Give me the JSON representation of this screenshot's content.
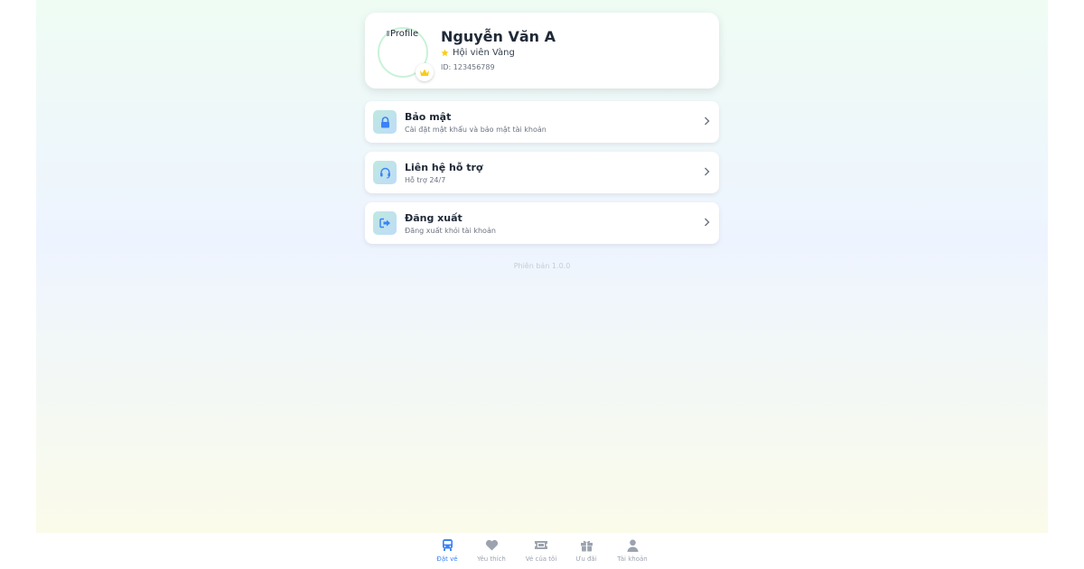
{
  "profile": {
    "avatar_alt": "Profile",
    "name": "Nguyễn Văn A",
    "membership": "Hội viên Vàng",
    "user_id": "ID: 123456789"
  },
  "menu": {
    "items": [
      {
        "title": "Bảo mật",
        "description": "Cài đặt mật khẩu và bảo mật tài khoản",
        "icon": "lock-icon"
      },
      {
        "title": "Liên hệ hỗ trợ",
        "description": "Hỗ trợ 24/7",
        "icon": "headset-icon"
      },
      {
        "title": "Đăng xuất",
        "description": "Đăng xuất khỏi tài khoản",
        "icon": "logout-icon"
      }
    ]
  },
  "version": "Phiên bản 1.0.0",
  "nav": {
    "active_index": 0,
    "items": [
      {
        "label": "Đặt vé",
        "icon": "bus-icon"
      },
      {
        "label": "Yêu thích",
        "icon": "heart-icon"
      },
      {
        "label": "Vé của tôi",
        "icon": "ticket-icon"
      },
      {
        "label": "Ưu đãi",
        "icon": "gift-icon"
      },
      {
        "label": "Tài khoản",
        "icon": "user-icon"
      }
    ]
  },
  "colors": {
    "accent": "#3b82f6",
    "crown": "#facc15",
    "icon_blue": "#3b82f6",
    "nav_inactive": "#9ca3af"
  }
}
